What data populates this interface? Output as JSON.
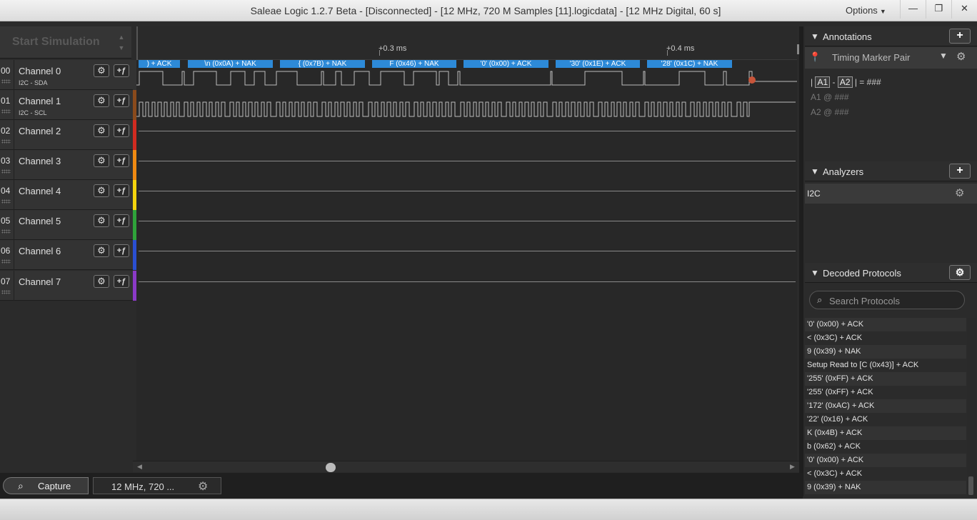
{
  "window": {
    "title": "Saleae Logic 1.2.7 Beta - [Disconnected] - [12 MHz, 720 M Samples [11].logicdata] - [12 MHz Digital, 60 s]",
    "options_label": "Options",
    "minimize_glyph": "—",
    "maximize_glyph": "❐",
    "close_glyph": "✕"
  },
  "simulation": {
    "start_label": "Start Simulation"
  },
  "channels": [
    {
      "num": "00",
      "name": "Channel 0",
      "sub": "I2C - SDA",
      "color": "#333333"
    },
    {
      "num": "01",
      "name": "Channel 1",
      "sub": "I2C - SCL",
      "color": "#8a4a1c"
    },
    {
      "num": "02",
      "name": "Channel 2",
      "sub": "",
      "color": "#d12b20"
    },
    {
      "num": "03",
      "name": "Channel 3",
      "sub": "",
      "color": "#f08a12"
    },
    {
      "num": "04",
      "name": "Channel 4",
      "sub": "",
      "color": "#f4d40d"
    },
    {
      "num": "05",
      "name": "Channel 5",
      "sub": "",
      "color": "#2fa33a"
    },
    {
      "num": "06",
      "name": "Channel 6",
      "sub": "",
      "color": "#2a4fd1"
    },
    {
      "num": "07",
      "name": "Channel 7",
      "sub": "",
      "color": "#8b3ac7"
    }
  ],
  "timeline": {
    "marks": [
      "+0.3 ms",
      "+0.4 ms"
    ]
  },
  "decode_labels": [
    ") + ACK",
    "\\n (0x0A) + NAK",
    "{ (0x7B) + NAK",
    "F (0x46) + NAK",
    "'0' (0x00) + ACK",
    "'30' (0x1E) + ACK",
    "'28' (0x1C) + NAK"
  ],
  "bottom_tabs": {
    "capture_label": "Capture",
    "session_label": "12 MHz, 720 ..."
  },
  "annotations": {
    "title": "Annotations",
    "add_label": "+",
    "marker_label": "Timing Marker Pair",
    "formula_a1": "A1",
    "formula_sep": "-",
    "formula_a2": "A2",
    "formula_result": "| = ###",
    "a1_line": "A1  @  ###",
    "a2_line": "A2  @  ###"
  },
  "analyzers": {
    "title": "Analyzers",
    "add_label": "+",
    "items": [
      "I2C"
    ]
  },
  "decoded": {
    "title": "Decoded Protocols",
    "search_placeholder": "Search Protocols",
    "items": [
      "'0' (0x00) + ACK",
      "< (0x3C) + ACK",
      "9 (0x39) + NAK",
      "Setup Read to [C (0x43)] + ACK",
      "'255' (0xFF) + ACK",
      "'255' (0xFF) + ACK",
      "'172' (0xAC) + ACK",
      "'22' (0x16) + ACK",
      "K (0x4B) + ACK",
      "b (0x62) + ACK",
      "'0' (0x00) + ACK",
      "< (0x3C) + ACK",
      "9 (0x39) + NAK"
    ]
  },
  "icons": {
    "gear": "gear-icon",
    "trigger": "trigger-icon",
    "search": "search-icon",
    "pin": "pin-icon"
  }
}
